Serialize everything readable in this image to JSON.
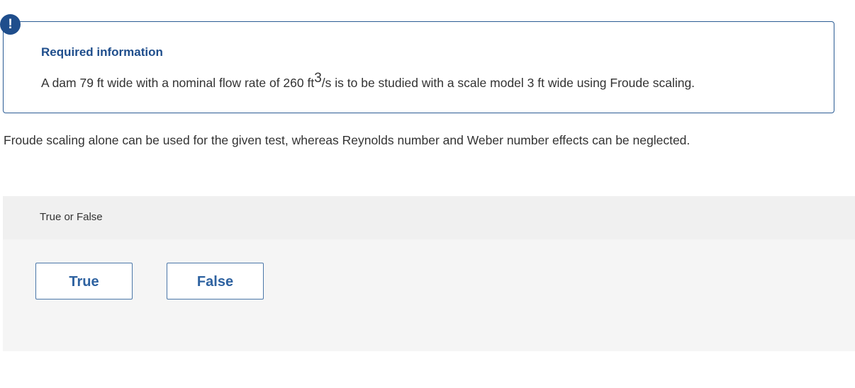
{
  "alert": {
    "icon": "exclamation-icon",
    "symbol": "!",
    "color": "#1f4e8c"
  },
  "info": {
    "title": "Required information",
    "text_before": "A dam 79 ft wide with a nominal flow rate of 260 ft",
    "superscript": "3",
    "text_after": "/s is to be studied with a scale model 3 ft wide using Froude scaling."
  },
  "question": {
    "text": "Froude scaling alone can be used for the given test, whereas Reynolds number and Weber number effects can be neglected."
  },
  "answer": {
    "type_label": "True or False",
    "options": [
      {
        "label": "True"
      },
      {
        "label": "False"
      }
    ]
  },
  "colors": {
    "accent": "#1f4e8c",
    "button_text": "#2e62a0",
    "panel_bg": "#f5f5f5"
  }
}
